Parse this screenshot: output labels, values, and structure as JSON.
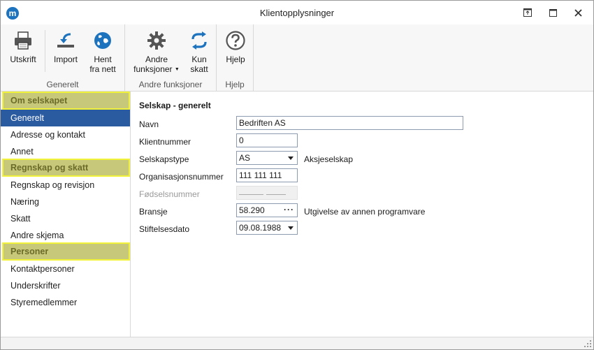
{
  "window": {
    "title": "Klientopplysninger",
    "logo_letter": "m"
  },
  "ribbon": {
    "groups": [
      {
        "label": "Generelt"
      },
      {
        "label": "Andre funksjoner"
      },
      {
        "label": "Hjelp"
      }
    ],
    "buttons": {
      "print": {
        "label": "Utskrift"
      },
      "import": {
        "label": "Import"
      },
      "fetch_line1": "Hent",
      "fetch_line2": "fra nett",
      "other_line1": "Andre",
      "other_line2": "funksjoner",
      "kun_line1": "Kun",
      "kun_line2": "skatt",
      "help": {
        "label": "Hjelp"
      }
    }
  },
  "sidebar": {
    "sections": [
      {
        "label": "Om selskapet"
      },
      {
        "label": "Regnskap og skatt"
      },
      {
        "label": "Personer"
      }
    ],
    "items": [
      {
        "label": "Generelt"
      },
      {
        "label": "Adresse og kontakt"
      },
      {
        "label": "Annet"
      },
      {
        "label": "Regnskap og revisjon"
      },
      {
        "label": "Næring"
      },
      {
        "label": "Skatt"
      },
      {
        "label": "Andre skjema"
      },
      {
        "label": "Kontaktpersoner"
      },
      {
        "label": "Underskrifter"
      },
      {
        "label": "Styremedlemmer"
      }
    ]
  },
  "form": {
    "heading": "Selskap - generelt",
    "navn": {
      "label": "Navn",
      "value": "Bedriften AS"
    },
    "klientnummer": {
      "label": "Klientnummer",
      "value": "0"
    },
    "selskapstype": {
      "label": "Selskapstype",
      "value": "AS",
      "note": "Aksjeselskap"
    },
    "orgnr": {
      "label": "Organisasjonsnummer",
      "value": "111 111 111"
    },
    "fodselsnr": {
      "label": "Fødselsnummer",
      "value": ""
    },
    "bransje": {
      "label": "Bransje",
      "value": "58.290",
      "note": "Utgivelse av annen programvare"
    },
    "stiftelsesdato": {
      "label": "Stiftelsesdato",
      "value": "09.08.1988"
    }
  }
}
